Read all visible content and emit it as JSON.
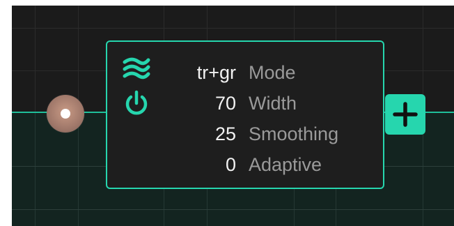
{
  "colors": {
    "accent": "#26d6ae",
    "canvas_background": "#1b1b1b",
    "lower_band": "#132420",
    "card_background": "#1e1e1e",
    "value_text": "#f2f2f2",
    "label_text": "#9a9a9a"
  },
  "node": {
    "icons": {
      "type_icon": "waves-icon",
      "power_icon": "power-icon"
    },
    "params": [
      {
        "value": "tr+gr",
        "label": "Mode"
      },
      {
        "value": "70",
        "label": "Width"
      },
      {
        "value": "25",
        "label": "Smoothing"
      },
      {
        "value": "0",
        "label": "Adaptive"
      }
    ]
  },
  "add_button": {
    "icon": "plus-icon"
  },
  "input_port": {
    "icon": "port-dot"
  }
}
